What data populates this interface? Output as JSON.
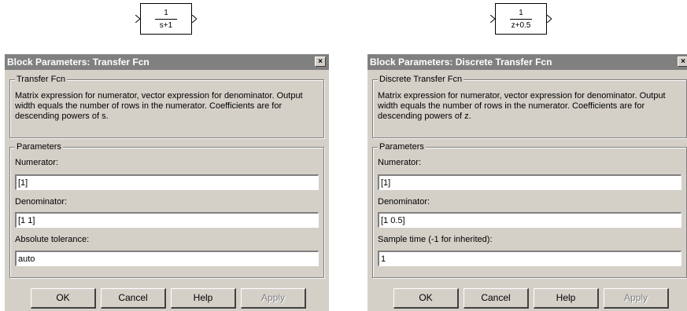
{
  "left_block": {
    "numerator": "1",
    "denominator": "s+1"
  },
  "right_block": {
    "numerator": "1",
    "denominator": "z+0.5"
  },
  "left_dialog": {
    "title": "Block Parameters: Transfer Fcn",
    "close_glyph": "×",
    "section_title": "Transfer Fcn",
    "description": "Matrix expression for numerator, vector expression for denominator. Output width equals the number of rows in the numerator.  Coefficients are for descending powers of s.",
    "parameters_title": "Parameters",
    "numerator_label": "Numerator:",
    "numerator_value": "[1]",
    "denominator_label": "Denominator:",
    "denominator_value": "[1 1]",
    "third_label": "Absolute tolerance:",
    "third_value": "auto",
    "buttons": {
      "ok": "OK",
      "cancel": "Cancel",
      "help": "Help",
      "apply": "Apply"
    }
  },
  "right_dialog": {
    "title": "Block Parameters: Discrete Transfer Fcn",
    "close_glyph": "×",
    "section_title": "Discrete Transfer Fcn",
    "description": "Matrix expression for numerator, vector expression for denominator. Output width equals the number of rows in the numerator.  Coefficients are for descending powers of z.",
    "parameters_title": "Parameters",
    "numerator_label": "Numerator:",
    "numerator_value": "[1]",
    "denominator_label": "Denominator:",
    "denominator_value": "[1 0.5]",
    "third_label": "Sample time (-1 for inherited):",
    "third_value": "1",
    "buttons": {
      "ok": "OK",
      "cancel": "Cancel",
      "help": "Help",
      "apply": "Apply"
    }
  }
}
